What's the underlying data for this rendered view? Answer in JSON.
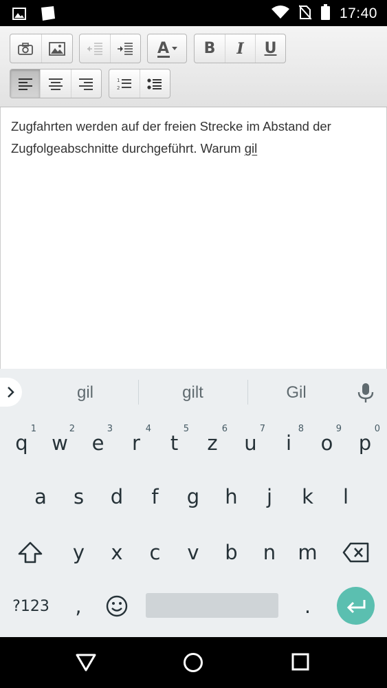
{
  "status_bar": {
    "time": "17:40",
    "icons": [
      "image-notification-icon",
      "note-notification-icon",
      "wifi-icon",
      "no-sim-icon",
      "battery-icon"
    ]
  },
  "toolbar": {
    "groups": [
      [
        "camera-icon",
        "image-icon"
      ],
      [
        "outdent-icon",
        "indent-icon"
      ],
      [
        "font-color-icon"
      ],
      [
        "bold-icon",
        "italic-icon",
        "underline-icon"
      ],
      [
        "align-left-icon",
        "align-center-icon",
        "align-right-icon"
      ],
      [
        "ordered-list-icon",
        "bullet-list-icon"
      ]
    ],
    "font_color_letter": "A",
    "bold_letter": "B",
    "italic_letter": "I",
    "underline_letter": "U",
    "active": "align-left"
  },
  "editor": {
    "text_before": "Zugfahrten werden auf der freien Strecke im Abstand der Zugfolgeabschnitte durchgeführt. Warum ",
    "composing_word": "gil"
  },
  "suggestions": [
    "gil",
    "gilt",
    "Gil"
  ],
  "keyboard": {
    "row1": [
      "q",
      "w",
      "e",
      "r",
      "t",
      "z",
      "u",
      "i",
      "o",
      "p"
    ],
    "row1_hints": [
      "1",
      "2",
      "3",
      "4",
      "5",
      "6",
      "7",
      "8",
      "9",
      "0"
    ],
    "row2": [
      "a",
      "s",
      "d",
      "f",
      "g",
      "h",
      "j",
      "k",
      "l"
    ],
    "row3": [
      "y",
      "x",
      "c",
      "v",
      "b",
      "n",
      "m"
    ],
    "symbols_label": "?123",
    "comma": ",",
    "period": ".",
    "accent_color": "#5bbfb0"
  },
  "nav_bar": {
    "icons": [
      "back-icon",
      "home-icon",
      "recents-icon"
    ]
  }
}
